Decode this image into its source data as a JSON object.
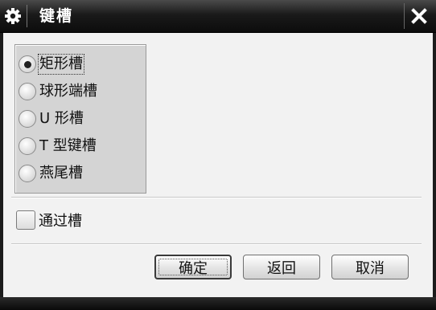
{
  "window": {
    "title": "键槽",
    "title_icon": "gear-icon",
    "close_icon": "close-icon"
  },
  "slot_types": {
    "selected_index": 0,
    "options": [
      {
        "label": "矩形槽",
        "selected": true
      },
      {
        "label": "球形端槽",
        "selected": false
      },
      {
        "label": "U 形槽",
        "selected": false
      },
      {
        "label": "T 型键槽",
        "selected": false
      },
      {
        "label": "燕尾槽",
        "selected": false
      }
    ]
  },
  "through_slot": {
    "label": "通过槽",
    "checked": false
  },
  "buttons": {
    "ok": "确定",
    "back": "返回",
    "cancel": "取消"
  },
  "colors": {
    "titlebar": "#141414",
    "client_bg": "#f2f2f2",
    "group_bg": "#d4d4d4"
  }
}
